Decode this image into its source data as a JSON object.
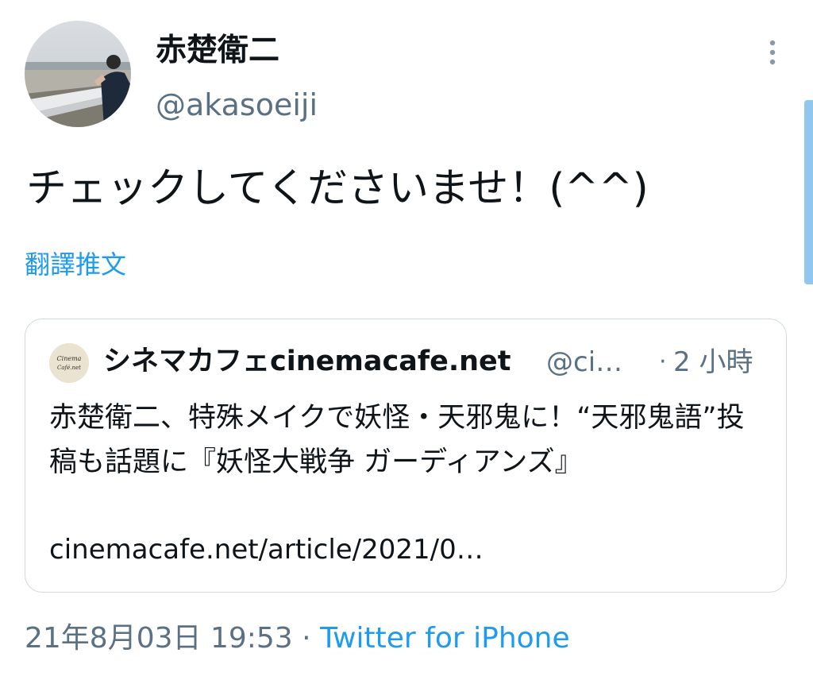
{
  "author": {
    "display_name": "赤楚衛二",
    "handle": "@akasoeiji"
  },
  "tweet": {
    "text": "チェックしてくださいませ！(^^)",
    "translate_label": "翻譯推文"
  },
  "quote": {
    "logo_text_top": "Cinema",
    "logo_text_bottom": "Café.net",
    "name": "シネマカフェcinemacafe.net",
    "handle": "@ci…",
    "separator": "·",
    "time": "2 小時",
    "text": "赤楚衛二、特殊メイクで妖怪・天邪鬼に！“天邪鬼語”投稿も話題に『妖怪大戦争 ガーディアンズ』",
    "link": "cinemacafe.net/article/2021/0…"
  },
  "meta": {
    "timestamp": "21年8月03日 19:53",
    "separator": "·",
    "source": "Twitter for iPhone"
  },
  "icons": {
    "more": "more-vertical-icon"
  },
  "colors": {
    "link": "#1d9bf0",
    "secondary": "#5b7083",
    "primary_text": "#0f1419",
    "border": "#cfd9de"
  }
}
